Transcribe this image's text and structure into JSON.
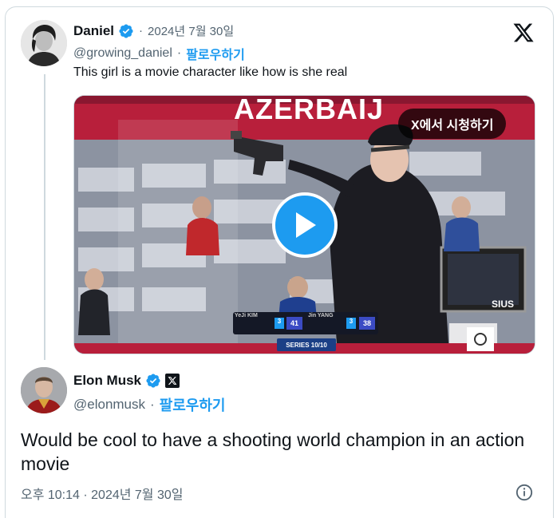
{
  "original_tweet": {
    "author_name": "Daniel",
    "author_handle": "@growing_daniel",
    "date": "2024년 7월 30일",
    "follow_label": "팔로우하기",
    "text": "This girl is a movie character like how is she real",
    "verified": true
  },
  "video": {
    "watch_on_x_label": "X에서 시청하기",
    "series_label": "SERIES 10/10",
    "score_left": "41",
    "score_right": "38",
    "score_left_rank": "3",
    "score_right_rank": "3",
    "player_left": "YeJi KIM",
    "player_right": "Jin YANG",
    "sponsor_text": "SIUS",
    "banner_text": "AZERBAIJ"
  },
  "reply_tweet": {
    "author_name": "Elon Musk",
    "author_handle": "@elonmusk",
    "follow_label": "팔로우하기",
    "text": "Would be cool to have a shooting world champion in an action movie",
    "timestamp": "오후 10:14 · 2024년 7월 30일",
    "verified": true
  },
  "colors": {
    "accent": "#1d9bf0",
    "text_primary": "#0f1419",
    "text_secondary": "#536471",
    "border": "#cfd9de"
  },
  "icons": [
    "x-logo-icon",
    "verified-badge-icon",
    "x-affiliate-badge-icon",
    "play-icon",
    "info-icon"
  ]
}
